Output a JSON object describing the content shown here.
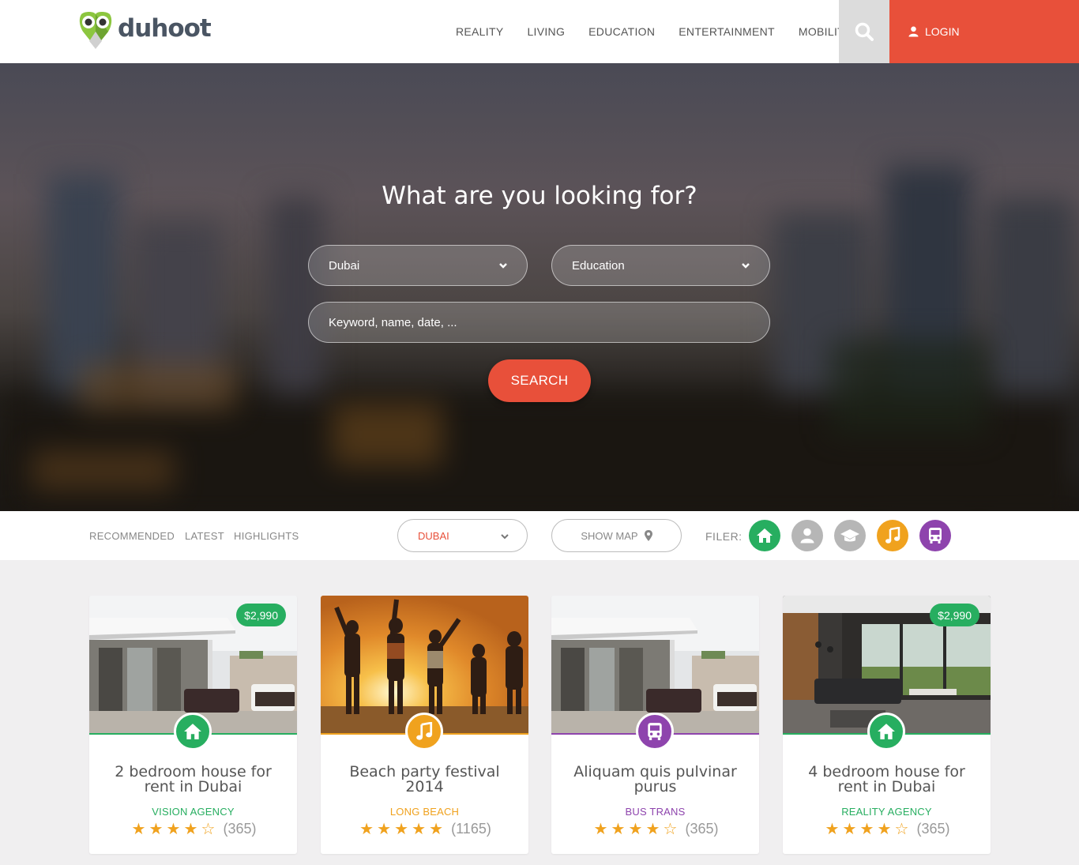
{
  "header": {
    "logo_text": "duhoot",
    "nav": [
      "REALITY",
      "LIVING",
      "EDUCATION",
      "ENTERTAINMENT",
      "MOBILITY"
    ],
    "login_label": "LOGIN"
  },
  "hero": {
    "title": "What are you looking for?",
    "location_value": "Dubai",
    "category_value": "Education",
    "keyword_placeholder": "Keyword, name, date, ...",
    "search_label": "SEARCH"
  },
  "filterbar": {
    "tabs": [
      "RECOMMENDED",
      "LATEST",
      "HIGHLIGHTS"
    ],
    "city_value": "DUBAI",
    "show_map_label": "SHOW MAP",
    "filer_label": "FILER:"
  },
  "cards": [
    {
      "title": "2 bedroom house for rent in Dubai",
      "subtitle": "VISION AGENCY",
      "price": "$2,990",
      "rating": 4,
      "count": "(365)"
    },
    {
      "title": "Beach party festival 2014",
      "subtitle": "LONG BEACH",
      "rating": 5,
      "count": "(1165)"
    },
    {
      "title": "Aliquam quis pulvinar purus",
      "subtitle": "BUS TRANS",
      "rating": 4,
      "count": "(365)"
    },
    {
      "title": "4 bedroom house for rent in Dubai",
      "subtitle": "REALITY AGENCY",
      "price": "$2,990",
      "rating": 4,
      "count": "(365)"
    }
  ],
  "colors": {
    "accent": "#e8503a",
    "reality": "#27ae60",
    "living": "#b6b6b6",
    "education": "#b6b6b6",
    "entertainment": "#f0a21e",
    "mobility": "#8e44ad"
  }
}
